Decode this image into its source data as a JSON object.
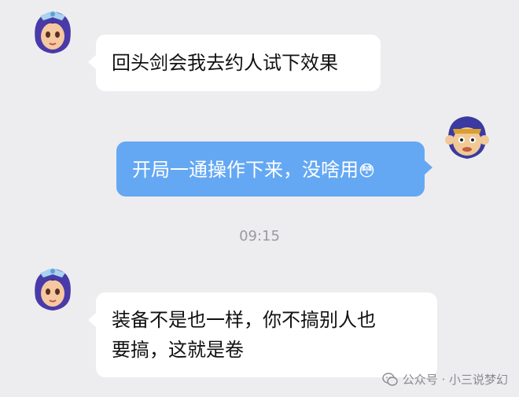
{
  "messages": [
    {
      "side": "in",
      "text": "回头剑会我去约人试下效果",
      "avatar": "female-character-avatar"
    },
    {
      "side": "out",
      "text": "开局一通操作下来，没啥用",
      "emoji": "😳",
      "avatar": "monkey-character-avatar"
    },
    {
      "side": "in",
      "text_line1": "装备不是也一样，你不搞别人也",
      "text_line2": "要搞，这就是卷",
      "avatar": "female-character-avatar"
    }
  ],
  "timestamp": "09:15",
  "watermark": {
    "text": "公众号 · 小三说梦幻",
    "icon": "wechat-icon"
  },
  "colors": {
    "background": "#ededf0",
    "bubble_in": "#ffffff",
    "bubble_out": "#64a8f3"
  }
}
